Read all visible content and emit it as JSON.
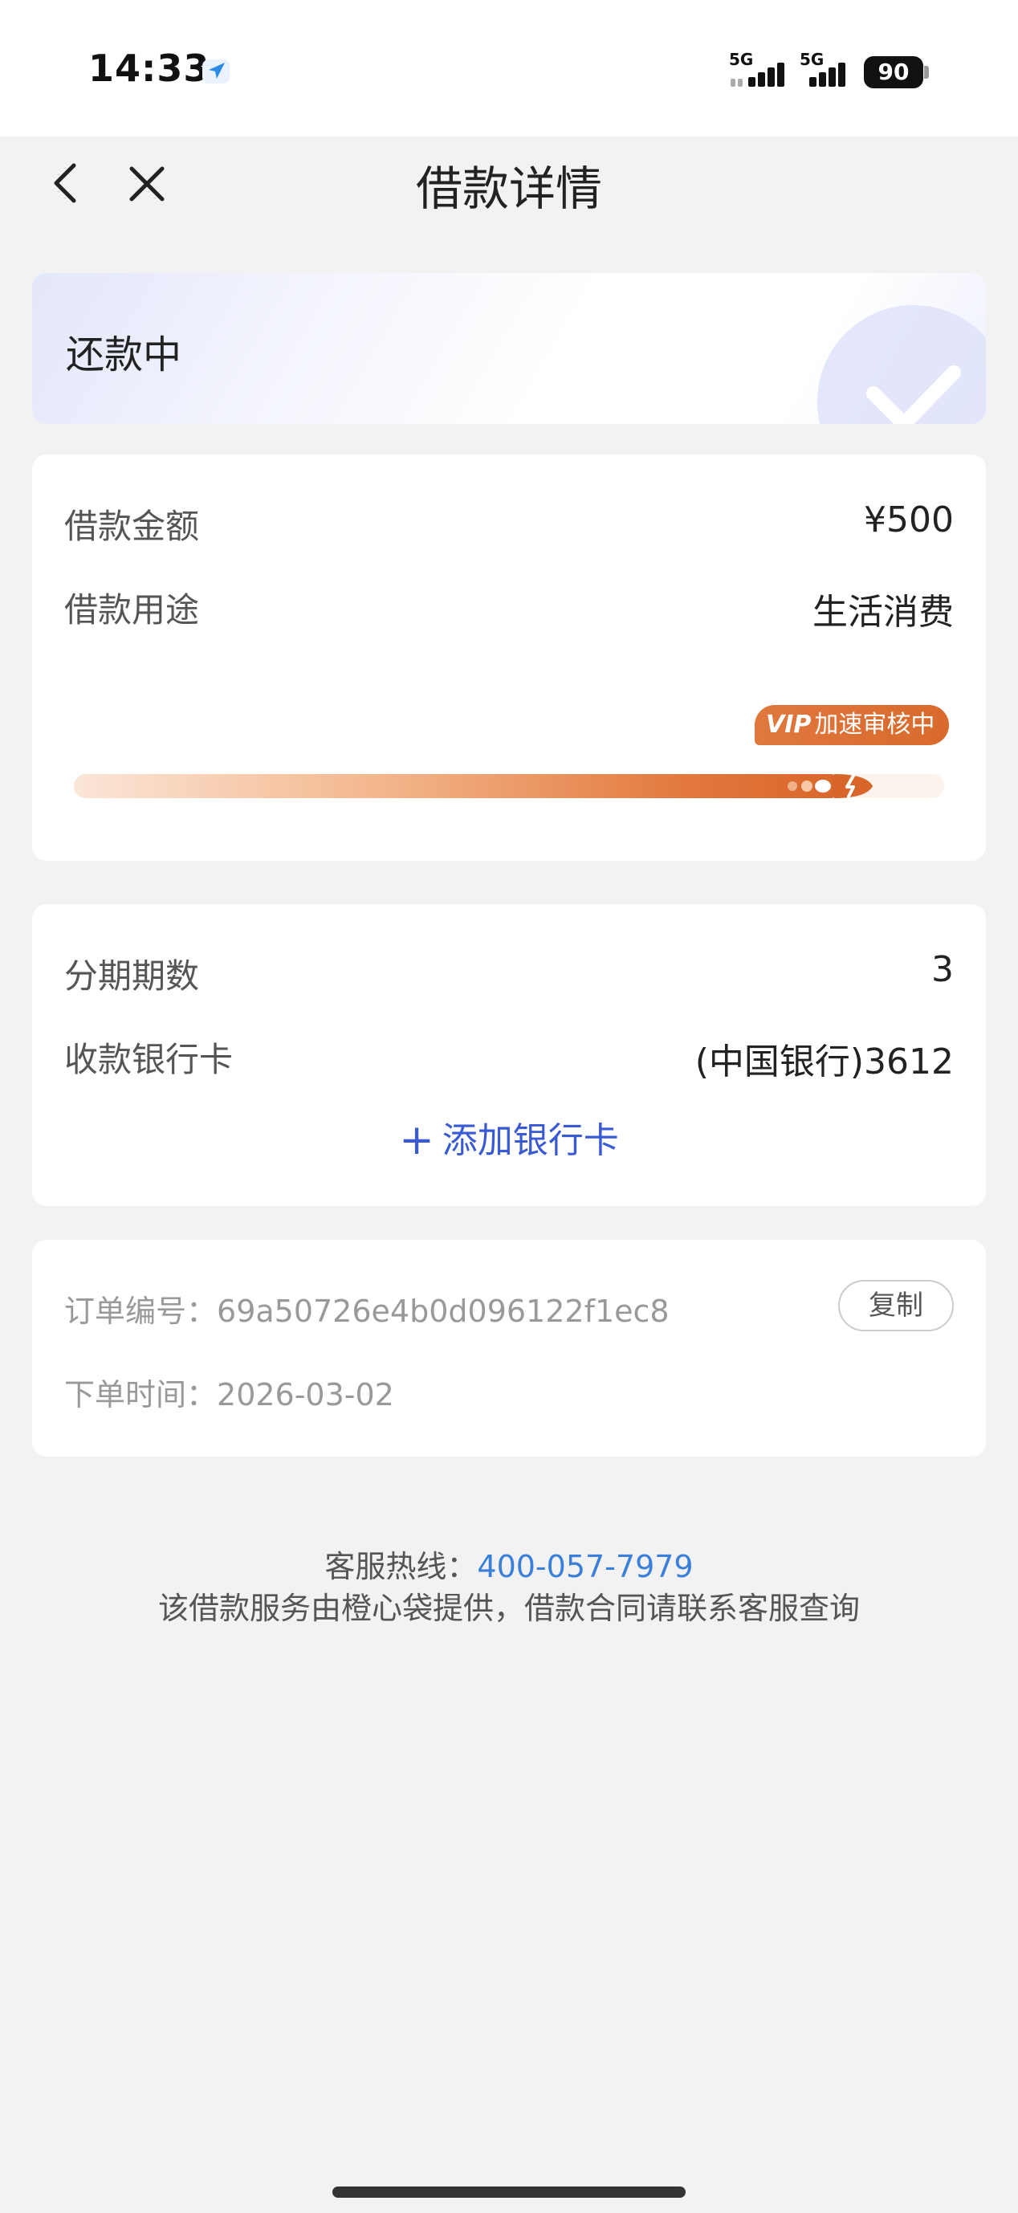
{
  "status_bar": {
    "time": "14:33",
    "network_1": "5G",
    "network_2": "5G",
    "battery": "90"
  },
  "header": {
    "title": "借款详情",
    "back_icon": "chevron-left-icon",
    "close_icon": "close-icon"
  },
  "status": {
    "label": "还款中",
    "icon": "check-circle-icon"
  },
  "loan": {
    "amount_label": "借款金额",
    "amount_value": "¥500",
    "purpose_label": "借款用途",
    "purpose_value": "生活消费",
    "progress_badge_vip": "VIP",
    "progress_badge_text": "加速审核中",
    "progress_fraction": 0.92
  },
  "bank": {
    "installments_label": "分期期数",
    "installments_value": "3",
    "card_label": "收款银行卡",
    "card_value": "(中国银行)3612",
    "add_card_label": "添加银行卡"
  },
  "order": {
    "number_label": "订单编号：",
    "number_value": "69a50726e4b0d096122f1ec8",
    "copy_label": "复制",
    "time_label": "下单时间：",
    "time_value": "2026-03-02"
  },
  "footer": {
    "hotline_label": "客服热线：",
    "hotline_number": "400-057-7979",
    "note": "该借款服务由橙心袋提供，借款合同请联系客服查询"
  },
  "colors": {
    "accent_blue": "#3a5ad4",
    "link_blue": "#3a7fd8",
    "progress_orange": "#d86a2c"
  }
}
